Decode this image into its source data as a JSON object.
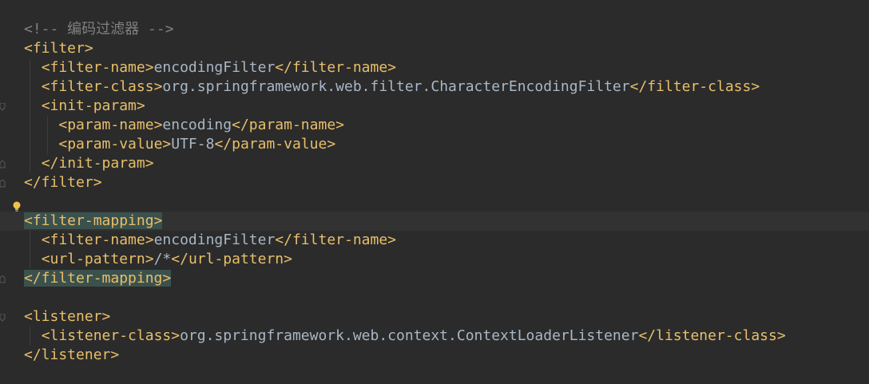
{
  "lines": [
    {
      "comment": "<!-- 编码过滤器 -->"
    },
    {
      "open": "<filter>"
    },
    {
      "open": "<filter-name>",
      "text": "encodingFilter",
      "close": "</filter-name>"
    },
    {
      "open": "<filter-class>",
      "text": "org.springframework.web.filter.CharacterEncodingFilter",
      "close": "</filter-class>"
    },
    {
      "open": "<init-param>"
    },
    {
      "open": "<param-name>",
      "text": "encoding",
      "close": "</param-name>"
    },
    {
      "open": "<param-value>",
      "text": "UTF-8",
      "close": "</param-value>"
    },
    {
      "open": "</init-param>"
    },
    {
      "open": "</filter>"
    },
    {},
    {
      "open": "<filter-mapping>"
    },
    {
      "open": "<filter-name>",
      "text": "encodingFilter",
      "close": "</filter-name>"
    },
    {
      "open": "<url-pattern>",
      "text": "/*",
      "close": "</url-pattern>"
    },
    {
      "open": "</filter-mapping>"
    },
    {},
    {
      "open": "<listener>"
    },
    {
      "open": "<listener-class>",
      "text": "org.springframework.web.context.ContextLoaderListener",
      "close": "</listener-class>"
    },
    {
      "open": "</listener>"
    }
  ],
  "colors": {
    "background": "#2b2b2b",
    "tag": "#e8bf6a",
    "text": "#a9b7c6",
    "comment": "#808080",
    "matched_tag_highlight": "#3b514d",
    "current_line": "#323232"
  },
  "icons": {
    "intention_bulb": "lightbulb-icon",
    "fold_marker": "fold-marker-icon"
  }
}
